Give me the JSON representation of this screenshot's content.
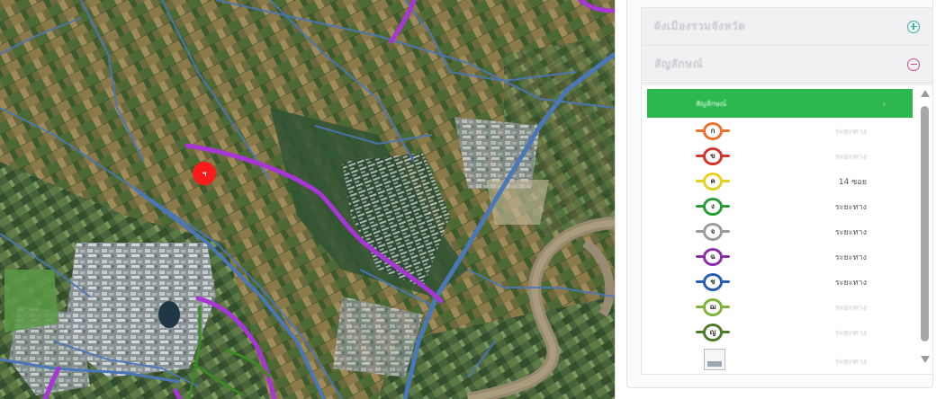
{
  "map": {
    "marker": {
      "label": "ฯ",
      "color": "#ff1a1a"
    },
    "colors": {
      "road": "#4a77b8",
      "highway": "#a637d4",
      "green_route": "#3b8a24",
      "river": "#9a8c74",
      "water": "#2a4a5a"
    }
  },
  "panel": {
    "section_1": {
      "title": "ผังเมืองรวมจังหวัด",
      "toggle_icon": "plus-circle-icon",
      "accent": "#33b3a0"
    },
    "section_2": {
      "title": "สัญลักษณ์",
      "toggle_icon": "minus-circle-icon",
      "accent": "#d14c8a"
    },
    "legend_header": {
      "left": "สัญลักษณ์",
      "right": "›",
      "color": "#2db74f"
    },
    "legend": [
      {
        "code": "ก",
        "color": "#e9732f",
        "value": "ระยะทาง"
      },
      {
        "code": "ข",
        "color": "#d3362c",
        "value": "ระยะทาง"
      },
      {
        "code": "ค",
        "color": "#e5d21c",
        "value": "14 ซอย"
      },
      {
        "code": "ง",
        "color": "#2a9c3a",
        "value": "ระยะทาง"
      },
      {
        "code": "จ",
        "color": "#9b9b9b",
        "value": "ระยะทาง"
      },
      {
        "code": "ฉ",
        "color": "#8a2fa8",
        "value": "ระยะทาง"
      },
      {
        "code": "ช",
        "color": "#2a5fb0",
        "value": "ระยะทาง"
      },
      {
        "code": "ฌ",
        "color": "#7fb43a",
        "value": "ระยะทาง"
      },
      {
        "code": "ญ",
        "color": "#4f7a2a",
        "value": "ระยะทาง"
      }
    ],
    "last_row": {
      "value": "ระยะทาง"
    }
  }
}
